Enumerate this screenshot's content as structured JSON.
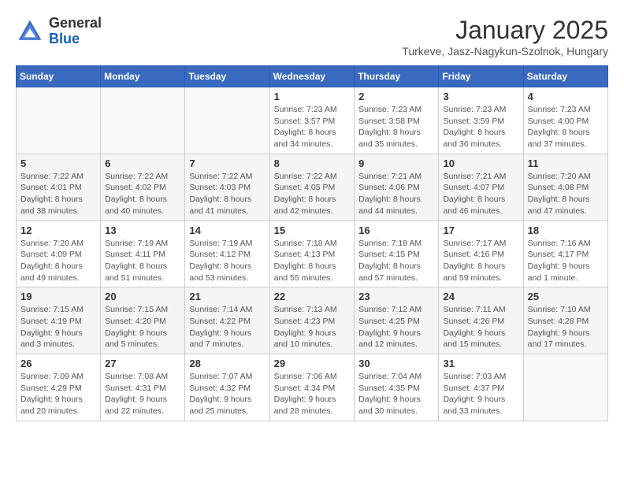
{
  "logo": {
    "line1": "General",
    "line2": "Blue"
  },
  "title": "January 2025",
  "location": "Turkeve, Jasz-Nagykun-Szolnok, Hungary",
  "weekdays": [
    "Sunday",
    "Monday",
    "Tuesday",
    "Wednesday",
    "Thursday",
    "Friday",
    "Saturday"
  ],
  "weeks": [
    [
      {
        "day": "",
        "info": ""
      },
      {
        "day": "",
        "info": ""
      },
      {
        "day": "",
        "info": ""
      },
      {
        "day": "1",
        "info": "Sunrise: 7:23 AM\nSunset: 3:57 PM\nDaylight: 8 hours\nand 34 minutes."
      },
      {
        "day": "2",
        "info": "Sunrise: 7:23 AM\nSunset: 3:58 PM\nDaylight: 8 hours\nand 35 minutes."
      },
      {
        "day": "3",
        "info": "Sunrise: 7:23 AM\nSunset: 3:59 PM\nDaylight: 8 hours\nand 36 minutes."
      },
      {
        "day": "4",
        "info": "Sunrise: 7:23 AM\nSunset: 4:00 PM\nDaylight: 8 hours\nand 37 minutes."
      }
    ],
    [
      {
        "day": "5",
        "info": "Sunrise: 7:22 AM\nSunset: 4:01 PM\nDaylight: 8 hours\nand 38 minutes."
      },
      {
        "day": "6",
        "info": "Sunrise: 7:22 AM\nSunset: 4:02 PM\nDaylight: 8 hours\nand 40 minutes."
      },
      {
        "day": "7",
        "info": "Sunrise: 7:22 AM\nSunset: 4:03 PM\nDaylight: 8 hours\nand 41 minutes."
      },
      {
        "day": "8",
        "info": "Sunrise: 7:22 AM\nSunset: 4:05 PM\nDaylight: 8 hours\nand 42 minutes."
      },
      {
        "day": "9",
        "info": "Sunrise: 7:21 AM\nSunset: 4:06 PM\nDaylight: 8 hours\nand 44 minutes."
      },
      {
        "day": "10",
        "info": "Sunrise: 7:21 AM\nSunset: 4:07 PM\nDaylight: 8 hours\nand 46 minutes."
      },
      {
        "day": "11",
        "info": "Sunrise: 7:20 AM\nSunset: 4:08 PM\nDaylight: 8 hours\nand 47 minutes."
      }
    ],
    [
      {
        "day": "12",
        "info": "Sunrise: 7:20 AM\nSunset: 4:09 PM\nDaylight: 8 hours\nand 49 minutes."
      },
      {
        "day": "13",
        "info": "Sunrise: 7:19 AM\nSunset: 4:11 PM\nDaylight: 8 hours\nand 51 minutes."
      },
      {
        "day": "14",
        "info": "Sunrise: 7:19 AM\nSunset: 4:12 PM\nDaylight: 8 hours\nand 53 minutes."
      },
      {
        "day": "15",
        "info": "Sunrise: 7:18 AM\nSunset: 4:13 PM\nDaylight: 8 hours\nand 55 minutes."
      },
      {
        "day": "16",
        "info": "Sunrise: 7:18 AM\nSunset: 4:15 PM\nDaylight: 8 hours\nand 57 minutes."
      },
      {
        "day": "17",
        "info": "Sunrise: 7:17 AM\nSunset: 4:16 PM\nDaylight: 8 hours\nand 59 minutes."
      },
      {
        "day": "18",
        "info": "Sunrise: 7:16 AM\nSunset: 4:17 PM\nDaylight: 9 hours\nand 1 minute."
      }
    ],
    [
      {
        "day": "19",
        "info": "Sunrise: 7:15 AM\nSunset: 4:19 PM\nDaylight: 9 hours\nand 3 minutes."
      },
      {
        "day": "20",
        "info": "Sunrise: 7:15 AM\nSunset: 4:20 PM\nDaylight: 9 hours\nand 5 minutes."
      },
      {
        "day": "21",
        "info": "Sunrise: 7:14 AM\nSunset: 4:22 PM\nDaylight: 9 hours\nand 7 minutes."
      },
      {
        "day": "22",
        "info": "Sunrise: 7:13 AM\nSunset: 4:23 PM\nDaylight: 9 hours\nand 10 minutes."
      },
      {
        "day": "23",
        "info": "Sunrise: 7:12 AM\nSunset: 4:25 PM\nDaylight: 9 hours\nand 12 minutes."
      },
      {
        "day": "24",
        "info": "Sunrise: 7:11 AM\nSunset: 4:26 PM\nDaylight: 9 hours\nand 15 minutes."
      },
      {
        "day": "25",
        "info": "Sunrise: 7:10 AM\nSunset: 4:28 PM\nDaylight: 9 hours\nand 17 minutes."
      }
    ],
    [
      {
        "day": "26",
        "info": "Sunrise: 7:09 AM\nSunset: 4:29 PM\nDaylight: 9 hours\nand 20 minutes."
      },
      {
        "day": "27",
        "info": "Sunrise: 7:08 AM\nSunset: 4:31 PM\nDaylight: 9 hours\nand 22 minutes."
      },
      {
        "day": "28",
        "info": "Sunrise: 7:07 AM\nSunset: 4:32 PM\nDaylight: 9 hours\nand 25 minutes."
      },
      {
        "day": "29",
        "info": "Sunrise: 7:06 AM\nSunset: 4:34 PM\nDaylight: 9 hours\nand 28 minutes."
      },
      {
        "day": "30",
        "info": "Sunrise: 7:04 AM\nSunset: 4:35 PM\nDaylight: 9 hours\nand 30 minutes."
      },
      {
        "day": "31",
        "info": "Sunrise: 7:03 AM\nSunset: 4:37 PM\nDaylight: 9 hours\nand 33 minutes."
      },
      {
        "day": "",
        "info": ""
      }
    ]
  ]
}
